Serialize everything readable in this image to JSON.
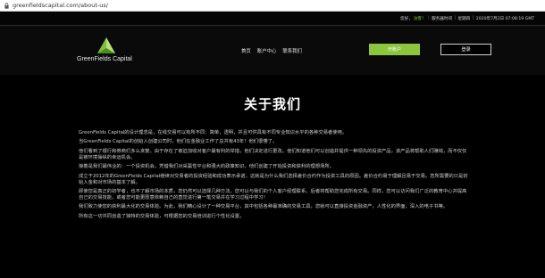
{
  "browser": {
    "url": "greenfieldscapital.com/about-us/"
  },
  "topbar": {
    "greeting": "您好，",
    "login_link": "访客！",
    "server_time_label": "服务器时间",
    "weekday": "星期四",
    "datetime": "2020年7月2日 07:08:19 GMT"
  },
  "header": {
    "logo_text": "GreenFields Capital",
    "nav": [
      "首页",
      "账户中心",
      "联系我们"
    ],
    "open_account": "开账户",
    "login": "登录"
  },
  "main": {
    "title": "关于我们",
    "paragraphs": [
      "GreenFields Capital的设计理念是，在线交易可以有所不同：简单，透明，并且可供具有不同专业知识水平的各种交易者使用。",
      "当GreenFields Capital的创始人创建公司时，他们在金融业工作了总共有43年！他们很懂了。",
      "他们看到了银行和券商们多么贪婪。由于存在了被迫加收对客户最有利的举措，他们决定进行更改。他们知道他们可以创造并提供一种领先的投资产品，该产品将帮助人们赚钱，而不仅仅是被环境操纵的幸运机会。",
      "接着是我们最伟业的：一个投资机会。凭借我们对采赢性平台和强大的政策知识，他们创建了开始投资和获利的理想场所。",
      "成立于2012年的GreenFields Capital继续对交易者的投资经验和成功表示承诺。这就是为什么我们选择差价合约作为投资工具的原因。差价合约易于理解且易于交易。您所需要的只是初始入金和对市场的基本了解。",
      "即使您是真正的初学者，也不了解市场的本质，您仍然可以选择几种方法。您可以与我们的个人客户经理联系，后者将帮助您完成所有交易。同样，您可以访问我们广泛的教育中心并提高自己的交易技能，或者您可能更愿意依赖自己的直觉进行第一笔交易并在学习过程中学习！",
      "我们致力使您的获利最大化的交易体验。为此，我们精心设计了一种交易平台，其中包括各种最准确的交易工具，您就可以直接投资金融资产，人性化的界面，深入的电子书等。",
      "所有这一切共同创造了独特的交易体验，可根据您的交易培训进行个性化设置。"
    ]
  },
  "colors": {
    "accent": "#8cc63f",
    "background": "#000000"
  }
}
